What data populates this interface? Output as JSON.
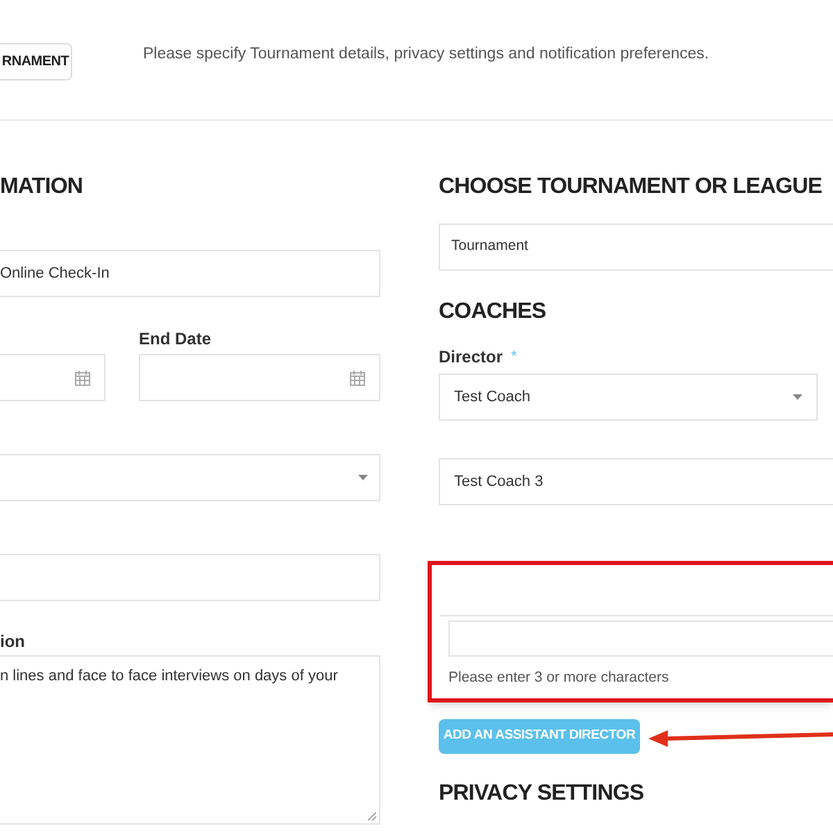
{
  "header": {
    "tab_button": "RNAMENT",
    "description": "Please specify Tournament details, privacy settings and notification preferences."
  },
  "left": {
    "heading": "MATION",
    "name_field": {
      "value": "Online Check-In"
    },
    "end_date_label": "End Date",
    "description_label": "ion",
    "description_value": "n lines and face to face interviews on days of your"
  },
  "right": {
    "heading": "CHOOSE TOURNAMENT OR LEAGUE",
    "type_field": {
      "value": "Tournament"
    },
    "coaches_heading": "COACHES",
    "director_label": "Director",
    "required_mark": "*",
    "director_select": {
      "value": "Test Coach"
    },
    "coach_field": {
      "value": "Test Coach 3"
    },
    "search_hint": "Please enter 3 or more characters",
    "add_button": "ADD AN ASSISTANT DIRECTOR",
    "privacy_heading": "PRIVACY SETTINGS"
  }
}
